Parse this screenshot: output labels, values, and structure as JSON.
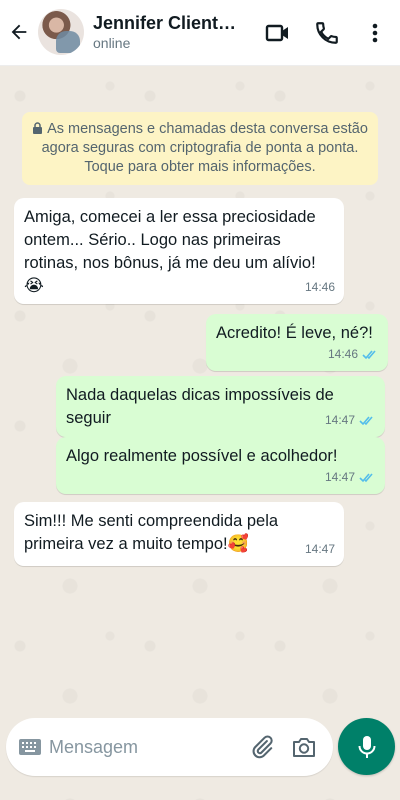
{
  "header": {
    "contact_name": "Jennifer Cliente…",
    "status": "online"
  },
  "chat": {
    "encryption_notice": "As mensagens e chamadas desta conversa estão agora seguras com criptografia de ponta a ponta. Toque para obter mais informações.",
    "messages": [
      {
        "direction": "incoming",
        "text": "Amiga, comecei a ler essa preciosidade ontem... Sério.. Logo nas primeiras rotinas, nos bônus, já me deu um alívio!",
        "emoji": "😭",
        "time": "14:46"
      },
      {
        "direction": "outgoing",
        "text": "Acredito! É leve, né?!",
        "time": "14:46",
        "read": true
      },
      {
        "direction": "outgoing",
        "text": "Nada daquelas dicas impossíveis de seguir",
        "time": "14:47",
        "read": true
      },
      {
        "direction": "outgoing",
        "text": "Algo realmente possível e acolhedor!",
        "time": "14:47",
        "read": true
      },
      {
        "direction": "incoming",
        "text": "Sim!!! Me senti compreendida pela primeira vez a muito tempo!",
        "emoji": "🥰",
        "time": "14:47"
      }
    ]
  },
  "composer": {
    "placeholder": "Mensagem"
  },
  "colors": {
    "accent": "#008069",
    "outgoing_bubble": "#d9fdd3",
    "read_ticks": "#53bdeb",
    "chat_background": "#efeae2"
  },
  "icons": [
    "back-arrow-icon",
    "video-call-icon",
    "phone-icon",
    "more-vert-icon",
    "lock-icon",
    "keyboard-icon",
    "attach-icon",
    "camera-icon",
    "mic-icon",
    "double-check-icon"
  ]
}
